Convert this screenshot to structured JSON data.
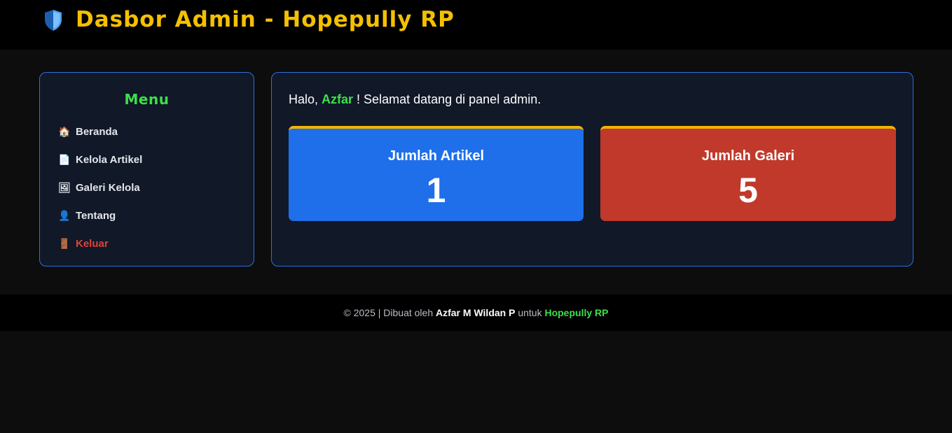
{
  "header": {
    "title": "Dasbor Admin - Hopepully RP",
    "icon": "shield-icon"
  },
  "sidebar": {
    "title": "Menu",
    "items": [
      {
        "label": "Beranda",
        "icon": "house-icon",
        "glyph": "🏠"
      },
      {
        "label": "Kelola Artikel",
        "icon": "document-icon",
        "glyph": "📄"
      },
      {
        "label": "Galeri Kelola",
        "icon": "picture-icon",
        "glyph": "🖼"
      },
      {
        "label": "Tentang",
        "icon": "user-icon",
        "glyph": "👤"
      },
      {
        "label": "Keluar",
        "icon": "door-icon",
        "glyph": "🚪"
      }
    ]
  },
  "main": {
    "greeting_prefix": "Halo, ",
    "username": "Azfar",
    "greeting_suffix": " ! Selamat datang di panel admin.",
    "stats": [
      {
        "label": "Jumlah Artikel",
        "value": "1"
      },
      {
        "label": "Jumlah Galeri",
        "value": "5"
      }
    ]
  },
  "footer": {
    "prefix": "© 2025 | Dibuat oleh ",
    "author": "Azfar M Wildan P",
    "middle": " untuk ",
    "project": "Hopepully RP"
  },
  "colors": {
    "accent_yellow": "#f5c000",
    "accent_green": "#3ce04a",
    "border_blue": "#2f6fdf",
    "card_blue": "#1f6feb",
    "card_red": "#c0392b",
    "logout_red": "#e0413a"
  }
}
